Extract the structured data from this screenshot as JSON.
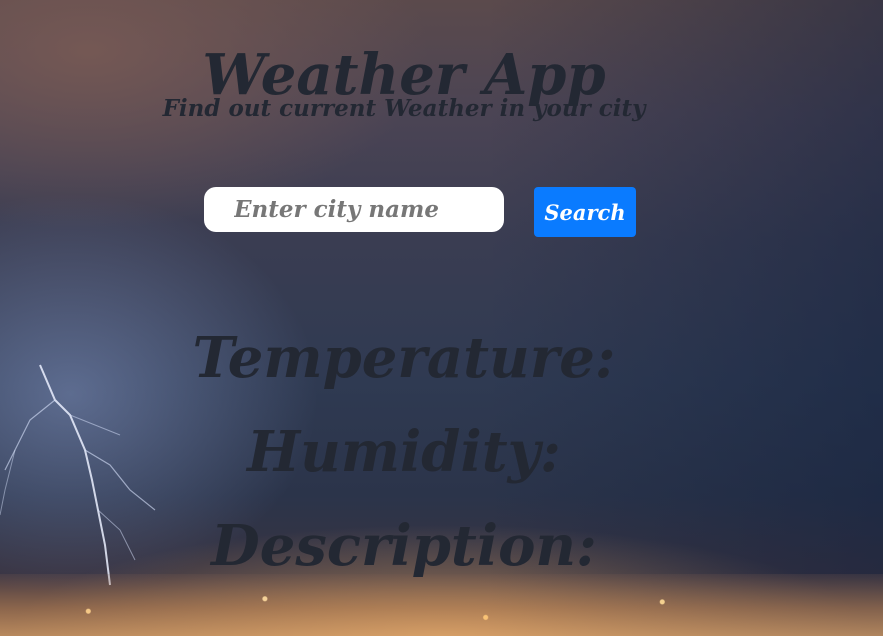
{
  "app": {
    "title": "Weather App",
    "subtitle": "Find out current Weather in your city"
  },
  "search": {
    "placeholder": "Enter city name",
    "value": "",
    "button_label": "Search"
  },
  "weather": {
    "temperature_label": "Temperature:",
    "humidity_label": "Humidity:",
    "description_label": "Description:"
  },
  "colors": {
    "button": "#0a7bff",
    "text": "#232833",
    "input_bg": "#ffffff"
  }
}
